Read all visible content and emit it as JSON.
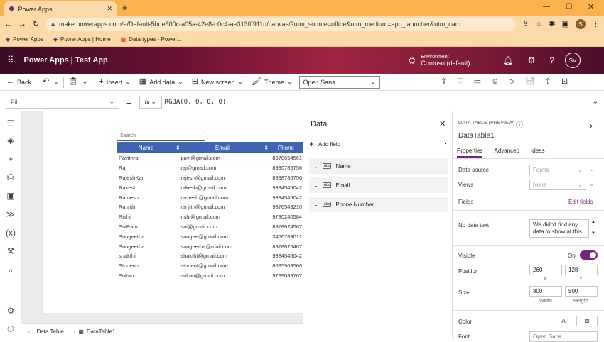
{
  "browser": {
    "tab_title": "Power Apps",
    "url": "make.powerapps.com/e/Default-5bde300c-a05a-42e8-b0c4-ae313fff911d/canvas/?utm_source=office&utm_medium=app_launcher&utm_cam...",
    "bookmarks": [
      "Power Apps",
      "Power Apps | Home",
      "Data types - Power..."
    ],
    "profile_initial": "S"
  },
  "header": {
    "title": "Power Apps | Test App",
    "environment_label": "Environment",
    "environment_name": "Contoso (default)",
    "avatar": "SV"
  },
  "toolbar": {
    "back": "Back",
    "insert": "Insert",
    "add_data": "Add data",
    "new_screen": "New screen",
    "theme": "Theme",
    "font": "Open Sans"
  },
  "formula": {
    "property": "Fill",
    "fx": "fx",
    "value": "RGBA(0, 0, 0, 0)"
  },
  "canvas": {
    "search_placeholder": "Search",
    "columns": [
      "Name",
      "Email",
      "Phone"
    ],
    "rows": [
      [
        "Pavithra",
        "pavi@gmail.com",
        "8978654561"
      ],
      [
        "Raj",
        "raj@gmail.com",
        "8990786756"
      ],
      [
        "RajeshKar",
        "rajesh@gmail.com",
        "8998786756"
      ],
      [
        "Rakesh",
        "rakesh@gmail.com",
        "9384545042"
      ],
      [
        "Ramesh",
        "ramesh@gmail.com",
        "9384545042"
      ],
      [
        "Ranjith",
        "ranjith@gmail.com",
        "9876543210"
      ],
      [
        "Rishi",
        "rishi@gmail.com",
        "9790240584"
      ],
      [
        "SaiRam",
        "sai@gmail.com",
        "8978674567"
      ],
      [
        "Sangeetha",
        "sangee@gmail.com",
        "3456789012"
      ],
      [
        "Sangeetha",
        "sangeetha@mail.com",
        "8978675467"
      ],
      [
        "shakthi",
        "shakthi@gmail.com",
        "9384545042"
      ],
      [
        "Students",
        "student@gmail.com",
        "8085908566"
      ],
      [
        "Sultan",
        "sultan@gmail.com",
        "9789089767"
      ]
    ]
  },
  "data_panel": {
    "title": "Data",
    "add_field": "Add field",
    "fields": [
      "Name",
      "Email",
      "Phone Number"
    ]
  },
  "properties": {
    "type_label": "DATA TABLE (PREVIEW)",
    "control_name": "DataTable1",
    "tabs": [
      "Properties",
      "Advanced",
      "Ideas"
    ],
    "data_source_label": "Data source",
    "data_source_value": "Forms",
    "views_label": "Views",
    "views_value": "None",
    "fields_label": "Fields",
    "edit_fields": "Edit fields",
    "no_data_label": "No data text",
    "no_data_value": "We didn't find any data to show at this",
    "visible_label": "Visible",
    "visible_value": "On",
    "position_label": "Position",
    "x": "260",
    "y": "128",
    "x_label": "X",
    "y_label": "Y",
    "size_label": "Size",
    "width": "800",
    "height": "500",
    "width_label": "Width",
    "height_label": "Height",
    "color_label": "Color",
    "font_label": "Font",
    "font_value": "Open Sans",
    "accent": "#742774"
  },
  "bottom": {
    "screen": "Data Table",
    "control": "DataTable1"
  }
}
